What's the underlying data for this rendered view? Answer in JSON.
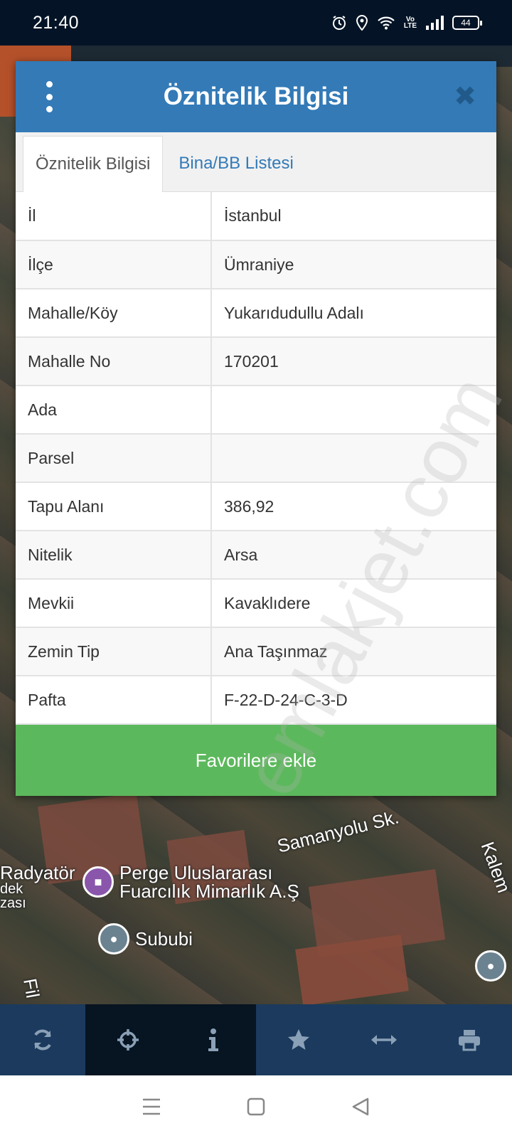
{
  "status_bar": {
    "time": "21:40",
    "battery": "44",
    "network_label_top": "Vo",
    "network_label_bottom": "LTE",
    "icons": [
      "alarm-icon",
      "location-icon",
      "wifi-icon",
      "volte-icon",
      "signal-icon",
      "battery-icon"
    ]
  },
  "dialog": {
    "title": "Öznitelik Bilgisi",
    "menu_icon": "more-vertical-icon",
    "close_icon": "close-icon",
    "tabs": [
      {
        "label": "Öznitelik Bilgisi",
        "active": true
      },
      {
        "label": "Bina/BB Listesi",
        "active": false
      }
    ],
    "rows": [
      {
        "key": "İl",
        "value": "İstanbul"
      },
      {
        "key": "İlçe",
        "value": "Ümraniye"
      },
      {
        "key": "Mahalle/Köy",
        "value": "Yukarıdudullu Adalı"
      },
      {
        "key": "Mahalle No",
        "value": "170201"
      },
      {
        "key": "Ada",
        "value": ""
      },
      {
        "key": "Parsel",
        "value": ""
      },
      {
        "key": "Tapu Alanı",
        "value": "386,92"
      },
      {
        "key": "Nitelik",
        "value": "Arsa"
      },
      {
        "key": "Mevkii",
        "value": "Kavaklıdere"
      },
      {
        "key": "Zemin Tip",
        "value": "Ana Taşınmaz"
      },
      {
        "key": "Pafta",
        "value": "F-22-D-24-C-3-D"
      }
    ],
    "favorite_button": "Favorilere ekle"
  },
  "map": {
    "labels": {
      "street_1": "Samanyolu Sk.",
      "street_2": "Kalem",
      "street_3": "Fil",
      "poi_1_line1": "Radyatör",
      "poi_1_line2": "dek",
      "poi_1_line3": "zası",
      "poi_2_line1": "Perge Uluslararası",
      "poi_2_line2": "Fuarcılık Mimarlık A.Ş",
      "poi_3": "Sububi"
    }
  },
  "toolbar": {
    "items": [
      {
        "icon": "refresh-icon"
      },
      {
        "icon": "crosshair-icon"
      },
      {
        "icon": "info-icon"
      },
      {
        "icon": "star-icon"
      },
      {
        "icon": "measure-icon"
      },
      {
        "icon": "print-icon"
      }
    ]
  },
  "navbar": {
    "items": [
      "menu-nav-icon",
      "home-nav-icon",
      "back-nav-icon"
    ]
  },
  "watermark": "emlakjet.com",
  "colors": {
    "header_blue": "#337ab7",
    "favorite_green": "#5cb85c",
    "toolbar_bg": "#1b3a5d",
    "status_bar_bg": "#041426"
  }
}
